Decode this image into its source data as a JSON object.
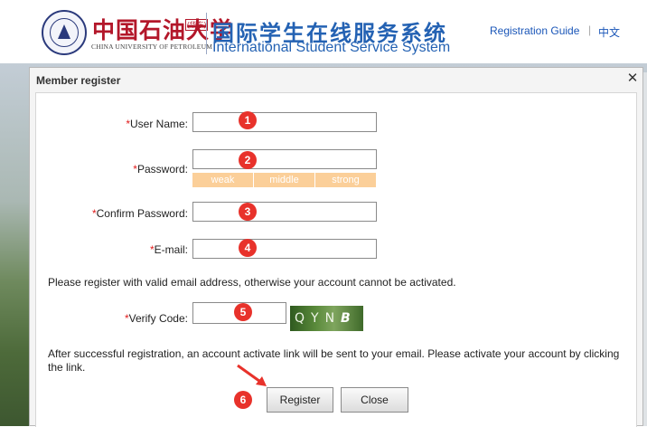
{
  "header": {
    "logo_cn": "中国石油大学",
    "logo_cn_tag": "(华东)",
    "logo_en": "CHINA UNIVERSITY OF PETROLEUM",
    "system_cn": "国际学生在线服务系统",
    "system_en": "International Student Service System",
    "registration_guide": "Registration Guide",
    "separator": "|",
    "language": "中文"
  },
  "modal": {
    "title": "Member register",
    "close_icon": "close-icon",
    "required_mark": "*",
    "fields": {
      "username": {
        "label": "User Name:",
        "value": "",
        "marker": "1"
      },
      "password": {
        "label": "Password:",
        "value": "",
        "marker": "2"
      },
      "confirm_password": {
        "label": "Confirm Password:",
        "value": "",
        "marker": "3"
      },
      "email": {
        "label": "E-mail:",
        "value": "",
        "marker": "4"
      },
      "verify_code": {
        "label": "Verify Code:",
        "value": "",
        "marker": "5"
      }
    },
    "strength": {
      "weak": "weak",
      "middle": "middle",
      "strong": "strong"
    },
    "email_note": "Please register with valid email address, otherwise your account cannot be activated.",
    "captcha": {
      "chars": "QYN",
      "last": "B"
    },
    "activation_note": "After successful registration, an account activate link will be sent to your email. Please activate your account by clicking the link.",
    "register_button": "Register",
    "close_button": "Close",
    "register_marker": "6"
  },
  "colors": {
    "brand_red": "#b3172a",
    "brand_blue": "#2462b3",
    "marker_red": "#e8322b",
    "strength_bar": "#fbcf99"
  }
}
